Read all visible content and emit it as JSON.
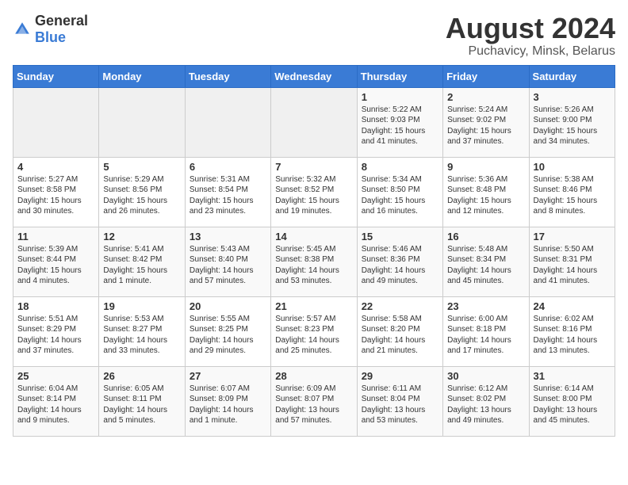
{
  "header": {
    "logo_general": "General",
    "logo_blue": "Blue",
    "month_year": "August 2024",
    "location": "Puchavicy, Minsk, Belarus"
  },
  "weekdays": [
    "Sunday",
    "Monday",
    "Tuesday",
    "Wednesday",
    "Thursday",
    "Friday",
    "Saturday"
  ],
  "weeks": [
    [
      {
        "day": "",
        "text": ""
      },
      {
        "day": "",
        "text": ""
      },
      {
        "day": "",
        "text": ""
      },
      {
        "day": "",
        "text": ""
      },
      {
        "day": "1",
        "text": "Sunrise: 5:22 AM\nSunset: 9:03 PM\nDaylight: 15 hours\nand 41 minutes."
      },
      {
        "day": "2",
        "text": "Sunrise: 5:24 AM\nSunset: 9:02 PM\nDaylight: 15 hours\nand 37 minutes."
      },
      {
        "day": "3",
        "text": "Sunrise: 5:26 AM\nSunset: 9:00 PM\nDaylight: 15 hours\nand 34 minutes."
      }
    ],
    [
      {
        "day": "4",
        "text": "Sunrise: 5:27 AM\nSunset: 8:58 PM\nDaylight: 15 hours\nand 30 minutes."
      },
      {
        "day": "5",
        "text": "Sunrise: 5:29 AM\nSunset: 8:56 PM\nDaylight: 15 hours\nand 26 minutes."
      },
      {
        "day": "6",
        "text": "Sunrise: 5:31 AM\nSunset: 8:54 PM\nDaylight: 15 hours\nand 23 minutes."
      },
      {
        "day": "7",
        "text": "Sunrise: 5:32 AM\nSunset: 8:52 PM\nDaylight: 15 hours\nand 19 minutes."
      },
      {
        "day": "8",
        "text": "Sunrise: 5:34 AM\nSunset: 8:50 PM\nDaylight: 15 hours\nand 16 minutes."
      },
      {
        "day": "9",
        "text": "Sunrise: 5:36 AM\nSunset: 8:48 PM\nDaylight: 15 hours\nand 12 minutes."
      },
      {
        "day": "10",
        "text": "Sunrise: 5:38 AM\nSunset: 8:46 PM\nDaylight: 15 hours\nand 8 minutes."
      }
    ],
    [
      {
        "day": "11",
        "text": "Sunrise: 5:39 AM\nSunset: 8:44 PM\nDaylight: 15 hours\nand 4 minutes."
      },
      {
        "day": "12",
        "text": "Sunrise: 5:41 AM\nSunset: 8:42 PM\nDaylight: 15 hours\nand 1 minute."
      },
      {
        "day": "13",
        "text": "Sunrise: 5:43 AM\nSunset: 8:40 PM\nDaylight: 14 hours\nand 57 minutes."
      },
      {
        "day": "14",
        "text": "Sunrise: 5:45 AM\nSunset: 8:38 PM\nDaylight: 14 hours\nand 53 minutes."
      },
      {
        "day": "15",
        "text": "Sunrise: 5:46 AM\nSunset: 8:36 PM\nDaylight: 14 hours\nand 49 minutes."
      },
      {
        "day": "16",
        "text": "Sunrise: 5:48 AM\nSunset: 8:34 PM\nDaylight: 14 hours\nand 45 minutes."
      },
      {
        "day": "17",
        "text": "Sunrise: 5:50 AM\nSunset: 8:31 PM\nDaylight: 14 hours\nand 41 minutes."
      }
    ],
    [
      {
        "day": "18",
        "text": "Sunrise: 5:51 AM\nSunset: 8:29 PM\nDaylight: 14 hours\nand 37 minutes."
      },
      {
        "day": "19",
        "text": "Sunrise: 5:53 AM\nSunset: 8:27 PM\nDaylight: 14 hours\nand 33 minutes."
      },
      {
        "day": "20",
        "text": "Sunrise: 5:55 AM\nSunset: 8:25 PM\nDaylight: 14 hours\nand 29 minutes."
      },
      {
        "day": "21",
        "text": "Sunrise: 5:57 AM\nSunset: 8:23 PM\nDaylight: 14 hours\nand 25 minutes."
      },
      {
        "day": "22",
        "text": "Sunrise: 5:58 AM\nSunset: 8:20 PM\nDaylight: 14 hours\nand 21 minutes."
      },
      {
        "day": "23",
        "text": "Sunrise: 6:00 AM\nSunset: 8:18 PM\nDaylight: 14 hours\nand 17 minutes."
      },
      {
        "day": "24",
        "text": "Sunrise: 6:02 AM\nSunset: 8:16 PM\nDaylight: 14 hours\nand 13 minutes."
      }
    ],
    [
      {
        "day": "25",
        "text": "Sunrise: 6:04 AM\nSunset: 8:14 PM\nDaylight: 14 hours\nand 9 minutes."
      },
      {
        "day": "26",
        "text": "Sunrise: 6:05 AM\nSunset: 8:11 PM\nDaylight: 14 hours\nand 5 minutes."
      },
      {
        "day": "27",
        "text": "Sunrise: 6:07 AM\nSunset: 8:09 PM\nDaylight: 14 hours\nand 1 minute."
      },
      {
        "day": "28",
        "text": "Sunrise: 6:09 AM\nSunset: 8:07 PM\nDaylight: 13 hours\nand 57 minutes."
      },
      {
        "day": "29",
        "text": "Sunrise: 6:11 AM\nSunset: 8:04 PM\nDaylight: 13 hours\nand 53 minutes."
      },
      {
        "day": "30",
        "text": "Sunrise: 6:12 AM\nSunset: 8:02 PM\nDaylight: 13 hours\nand 49 minutes."
      },
      {
        "day": "31",
        "text": "Sunrise: 6:14 AM\nSunset: 8:00 PM\nDaylight: 13 hours\nand 45 minutes."
      }
    ]
  ]
}
